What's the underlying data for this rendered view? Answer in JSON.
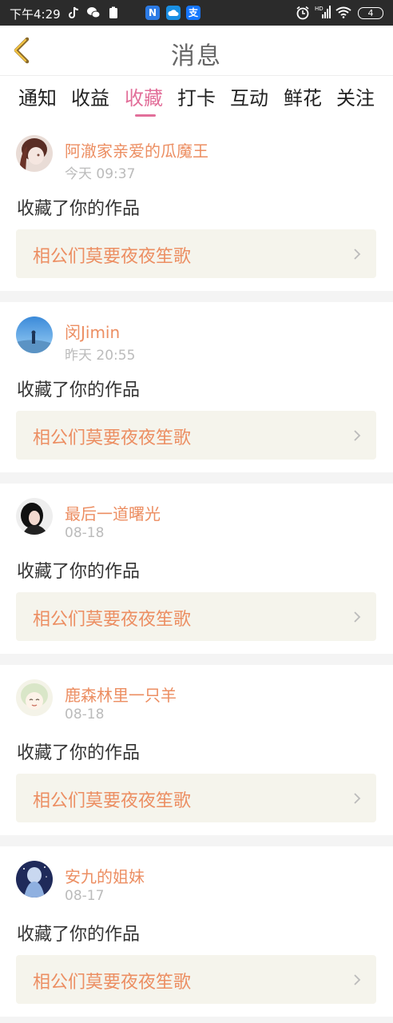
{
  "status_bar": {
    "time": "下午4:29",
    "network_label": "HD",
    "battery": "4"
  },
  "header": {
    "title": "消息"
  },
  "tabs": [
    {
      "label": "通知"
    },
    {
      "label": "收益"
    },
    {
      "label": "收藏"
    },
    {
      "label": "打卡"
    },
    {
      "label": "互动"
    },
    {
      "label": "鲜花"
    },
    {
      "label": "关注"
    }
  ],
  "active_tab": "收藏",
  "colors": {
    "accent_pink": "#e26f9a",
    "accent_orange": "#ec8e62",
    "work_box_bg": "#f5f4ec"
  },
  "messages": [
    {
      "username": "阿澈家亲爱的瓜魔王",
      "time": "今天 09:37",
      "action": "收藏了你的作品",
      "work_title": "相公们莫要夜夜笙歌"
    },
    {
      "username": "闵Jimin",
      "time": "昨天 20:55",
      "action": "收藏了你的作品",
      "work_title": "相公们莫要夜夜笙歌"
    },
    {
      "username": "最后一道曙光",
      "time": "08-18",
      "action": "收藏了你的作品",
      "work_title": "相公们莫要夜夜笙歌"
    },
    {
      "username": "鹿森林里一只羊",
      "time": "08-18",
      "action": "收藏了你的作品",
      "work_title": "相公们莫要夜夜笙歌"
    },
    {
      "username": "安九的姐妹",
      "time": "08-17",
      "action": "收藏了你的作品",
      "work_title": "相公们莫要夜夜笙歌"
    }
  ]
}
